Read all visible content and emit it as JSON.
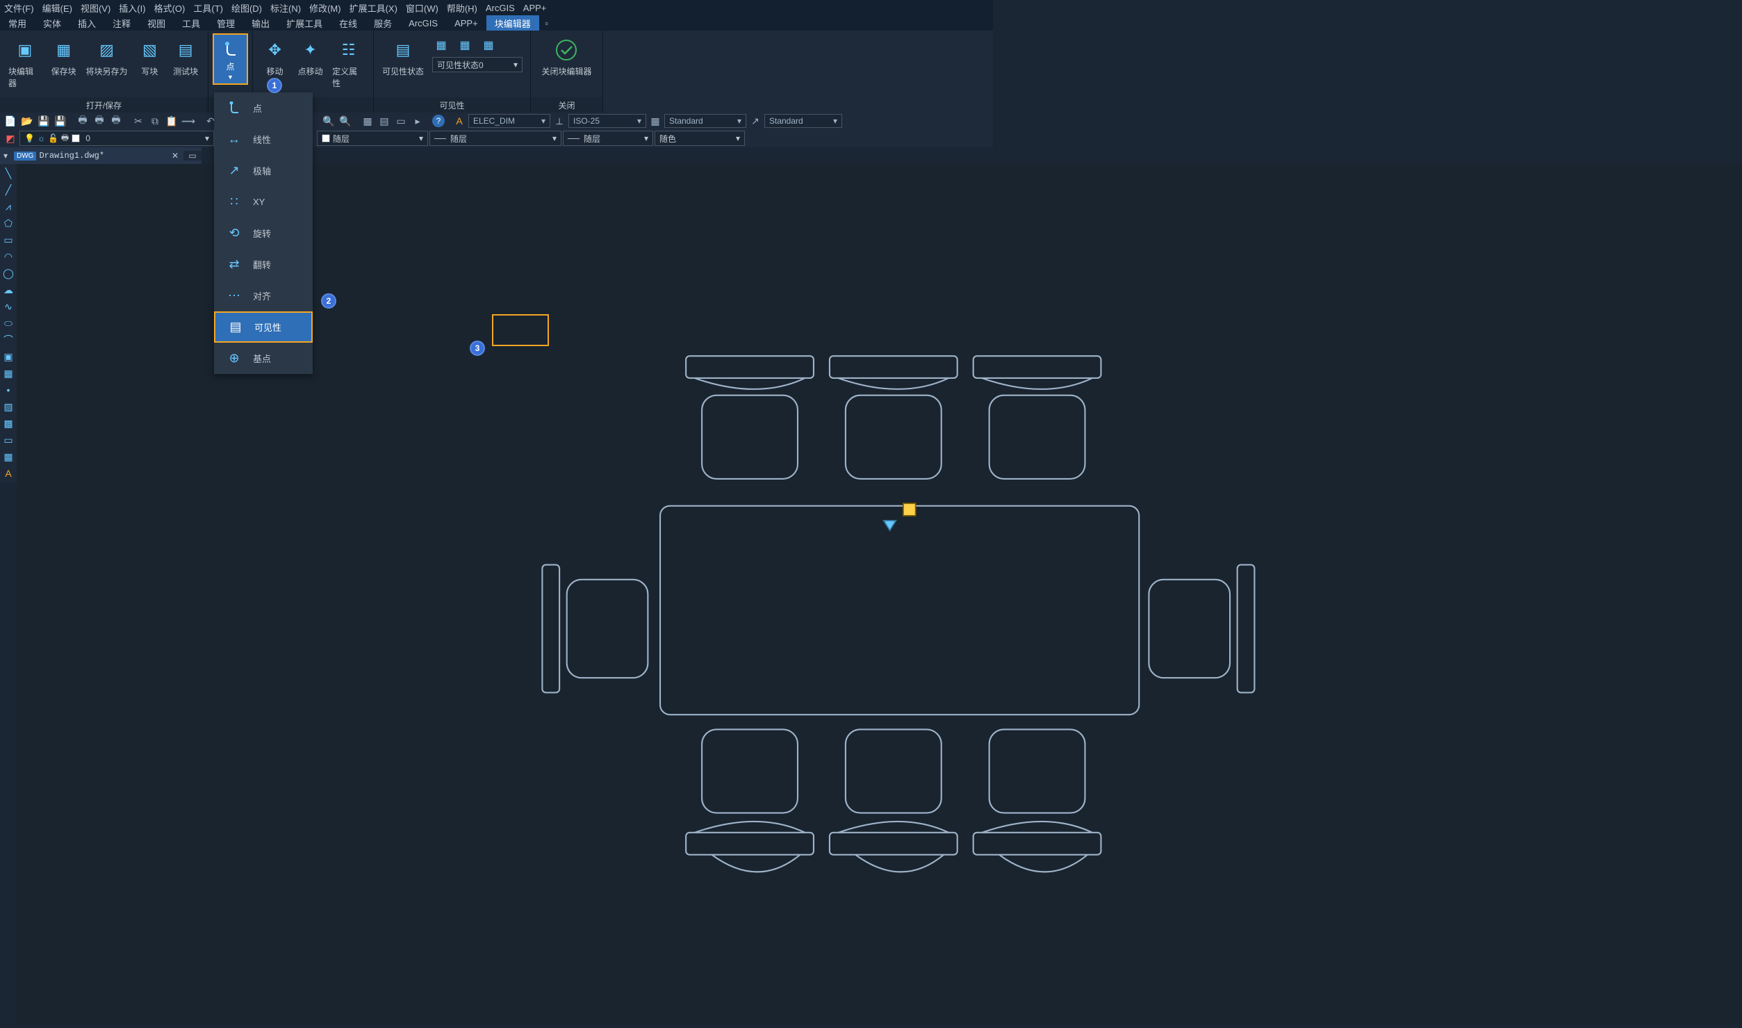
{
  "menubar": {
    "items": [
      "文件(F)",
      "编辑(E)",
      "视图(V)",
      "插入(I)",
      "格式(O)",
      "工具(T)",
      "绘图(D)",
      "标注(N)",
      "修改(M)",
      "扩展工具(X)",
      "窗口(W)",
      "帮助(H)",
      "ArcGIS",
      "APP+"
    ]
  },
  "ribbonTabs": {
    "items": [
      "常用",
      "实体",
      "插入",
      "注释",
      "视图",
      "工具",
      "管理",
      "输出",
      "扩展工具",
      "在线",
      "服务",
      "ArcGIS",
      "APP+",
      "块编辑器"
    ],
    "active": "块编辑器"
  },
  "ribbon": {
    "panel_open": {
      "title": "打开/保存",
      "buttons": {
        "edit": "块编辑器",
        "save": "保存块",
        "saveas": "将块另存为",
        "write": "写块",
        "test": "测试块"
      }
    },
    "panel_point": {
      "btn": "点"
    },
    "panel_move": {
      "btn": "移动",
      "btn2": "点移动",
      "btn3": "定义属性"
    },
    "panel_vis": {
      "title": "可见性",
      "btn": "可见性状态",
      "combo": "可见性状态0"
    },
    "panel_close": {
      "title": "关闭",
      "btn": "关闭块编辑器"
    }
  },
  "dropdown": {
    "items": [
      "点",
      "线性",
      "极轴",
      "XY",
      "旋转",
      "翻转",
      "对齐",
      "可见性",
      "基点"
    ],
    "highlight": "可见性"
  },
  "toolbar1": {
    "combo1": "ELEC_DIM",
    "combo2": "ISO-25",
    "combo3": "Standard",
    "combo4": "Standard"
  },
  "toolbar2": {
    "layer": "0",
    "c2": "随层",
    "c3": "随层",
    "c4": "随层",
    "c5": "随色"
  },
  "filetabs": {
    "name": "Drawing1.dwg*",
    "badge": "DWG"
  },
  "callouts": {
    "c1": "1",
    "c2": "2",
    "c3": "3"
  }
}
